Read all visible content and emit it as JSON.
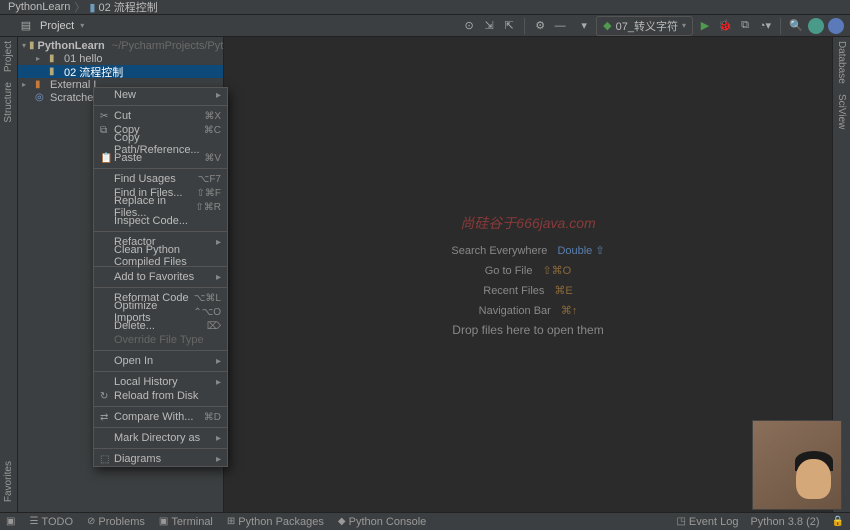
{
  "breadcrumb": {
    "root": "PythonLearn",
    "current": "02 流程控制"
  },
  "toolbar": {
    "project_label": "Project",
    "run_config": "07_转义字符"
  },
  "tree": {
    "root": "PythonLearn",
    "root_path": "~/PycharmProjects/PythonLearn",
    "items": [
      {
        "label": "01 hello"
      },
      {
        "label": "02 流程控制",
        "selected": true
      }
    ],
    "external": "External L",
    "scratches": "Scratches"
  },
  "context_menu": [
    {
      "label": "New",
      "submenu": true
    },
    {
      "sep": true
    },
    {
      "icon": "✂",
      "label": "Cut",
      "shortcut": "⌘X"
    },
    {
      "icon": "⧉",
      "label": "Copy",
      "shortcut": "⌘C"
    },
    {
      "label": "Copy Path/Reference..."
    },
    {
      "icon": "📋",
      "label": "Paste",
      "shortcut": "⌘V"
    },
    {
      "sep": true
    },
    {
      "label": "Find Usages",
      "shortcut": "⌥F7"
    },
    {
      "label": "Find in Files...",
      "shortcut": "⇧⌘F"
    },
    {
      "label": "Replace in Files...",
      "shortcut": "⇧⌘R"
    },
    {
      "label": "Inspect Code..."
    },
    {
      "sep": true
    },
    {
      "label": "Refactor",
      "submenu": true
    },
    {
      "label": "Clean Python Compiled Files"
    },
    {
      "sep": true
    },
    {
      "label": "Add to Favorites",
      "submenu": true
    },
    {
      "sep": true
    },
    {
      "label": "Reformat Code",
      "shortcut": "⌥⌘L"
    },
    {
      "label": "Optimize Imports",
      "shortcut": "⌃⌥O"
    },
    {
      "label": "Delete...",
      "shortcut": "⌦"
    },
    {
      "label": "Override File Type",
      "disabled": true
    },
    {
      "sep": true
    },
    {
      "label": "Open In",
      "submenu": true
    },
    {
      "sep": true
    },
    {
      "label": "Local History",
      "submenu": true
    },
    {
      "icon": "↻",
      "label": "Reload from Disk"
    },
    {
      "sep": true
    },
    {
      "icon": "⇄",
      "label": "Compare With...",
      "shortcut": "⌘D"
    },
    {
      "sep": true
    },
    {
      "label": "Mark Directory as",
      "submenu": true
    },
    {
      "sep": true
    },
    {
      "icon": "⬚",
      "label": "Diagrams",
      "submenu": true
    }
  ],
  "editor_tips": {
    "watermark": "尚硅谷于666java.com",
    "t1_label": "Search Everywhere",
    "t1_key": "Double ⇧",
    "t2_label": "Go to File",
    "t2_key": "⇧⌘O",
    "t3_label": "Recent Files",
    "t3_key": "⌘E",
    "t4_label": "Navigation Bar",
    "t4_key": "⌘↑",
    "t5_label": "Drop files here to open them"
  },
  "gutters": {
    "left": [
      "Project",
      "Structure",
      "Favorites"
    ],
    "right": [
      "Database",
      "SciView"
    ]
  },
  "statusbar": {
    "todo": "TODO",
    "problems": "Problems",
    "terminal": "Terminal",
    "pypkg": "Python Packages",
    "pycon": "Python Console",
    "event_log": "Event Log",
    "interpreter": "Python 3.8 (2)"
  }
}
